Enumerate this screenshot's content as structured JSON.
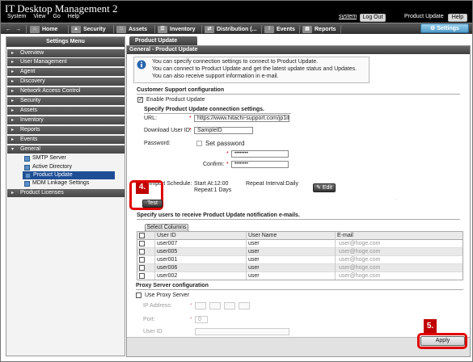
{
  "app": {
    "title": "IT Desktop Management 2",
    "menu": [
      "System",
      "View",
      "Go",
      "Help"
    ],
    "user": "system",
    "logout_label": "Log Out",
    "product_update_label": "Product Update",
    "help_label": "Help"
  },
  "nav": {
    "back_icon": "back-arrow-icon",
    "forward_icon": "forward-arrow-icon",
    "items": [
      {
        "label": "Home",
        "icon": "home-icon"
      },
      {
        "label": "Security",
        "icon": "shield-icon"
      },
      {
        "label": "Assets",
        "icon": "assets-icon"
      },
      {
        "label": "Inventory",
        "icon": "inventory-icon"
      },
      {
        "label": "Distribution (...",
        "icon": "distribution-icon"
      },
      {
        "label": "Events",
        "icon": "events-icon"
      },
      {
        "label": "Reports",
        "icon": "reports-icon"
      }
    ],
    "settings_label": "Settings"
  },
  "sidebar": {
    "title": "Settings Menu",
    "items": [
      {
        "label": "Overview"
      },
      {
        "label": "User Management"
      },
      {
        "label": "Agent"
      },
      {
        "label": "Discovery"
      },
      {
        "label": "Network Access Control"
      },
      {
        "label": "Security"
      },
      {
        "label": "Assets"
      },
      {
        "label": "Inventory"
      },
      {
        "label": "Reports"
      },
      {
        "label": "Events"
      },
      {
        "label": "General"
      },
      {
        "label": "Product Licenses"
      }
    ],
    "general_sub": [
      {
        "label": "SMTP Server"
      },
      {
        "label": "Active Directory"
      },
      {
        "label": "Product Update"
      },
      {
        "label": "MDM Linkage Settings"
      }
    ]
  },
  "page": {
    "tab_label": "Product Update",
    "header": "General - Product Update",
    "info_lines": [
      "You can specify connection settings to connect to Product Update.",
      "You can connect to Product Update and get the latest update status and Updates.",
      "You can also receive support information in e-mail."
    ],
    "support_section": "Customer Support configuration",
    "enable_label": "Enable Product Update",
    "conn_section": "Specify Product Update connection settings.",
    "url_label": "URL:",
    "url_value": "https://www.hitachi-support.com/jp1itc",
    "download_id_label": "Download User ID:",
    "download_id_value": "SampleID",
    "password_label": "Password:",
    "set_password_label": "Set password",
    "password_value": "••••••••",
    "confirm_label": "Confirm:",
    "confirm_value": "••••••••",
    "schedule_label": "it Import Schedule:",
    "schedule_start": "Start At:12:00",
    "schedule_repeat": "Repeat Interval:Daily",
    "schedule_repeat_days": "Repeat:1 Days",
    "edit_label": "Edit",
    "test_label": "Test",
    "callout_test": "4.",
    "notify_section": "Specify users to receive Product Update notification e-mails.",
    "select_columns_label": "Select Columns",
    "columns": [
      "User ID",
      "User Name",
      "E-mail"
    ],
    "users": [
      {
        "id": "user007",
        "name": "user",
        "email": "user@hoge.com"
      },
      {
        "id": "user005",
        "name": "user",
        "email": "user@hoge.com"
      },
      {
        "id": "user001",
        "name": "user",
        "email": "user@hoge.com"
      },
      {
        "id": "user006",
        "name": "user",
        "email": "user@hoge.com"
      },
      {
        "id": "user002",
        "name": "user",
        "email": "user@hoge.com"
      }
    ],
    "proxy_section": "Proxy Server configuration",
    "use_proxy_label": "Use Proxy Server",
    "ip_label": "IP Address:",
    "port_label": "Port:",
    "port_value": "0",
    "proxy_user_label": "User ID",
    "apply_label": "Apply",
    "callout_apply": "5."
  },
  "colors": {
    "accent": "#1f4e96",
    "callout": "#c00000",
    "highlight": "#e00000"
  }
}
